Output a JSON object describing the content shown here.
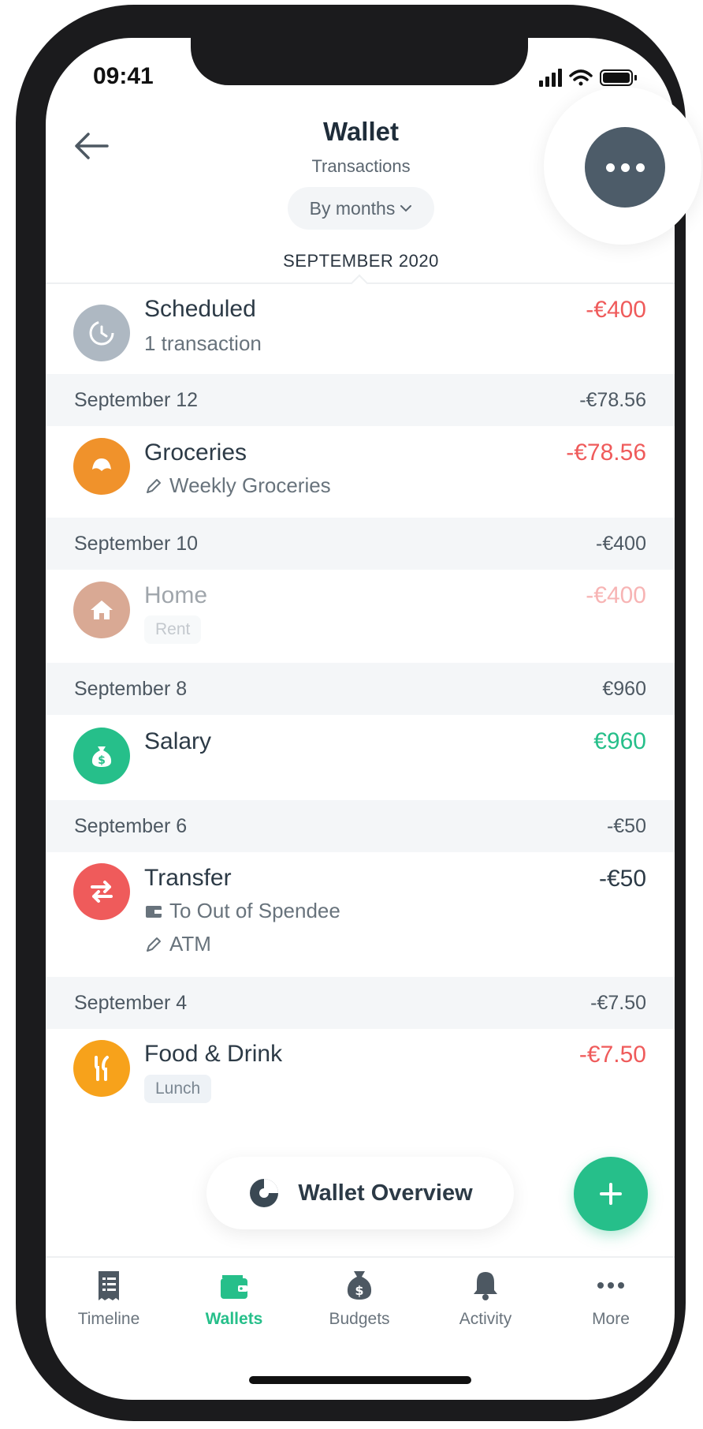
{
  "status": {
    "time": "09:41"
  },
  "header": {
    "title": "Wallet",
    "subtitle": "Transactions",
    "filter_label": "By months",
    "month": "SEPTEMBER 2020"
  },
  "scheduled": {
    "title": "Scheduled",
    "subtitle": "1 transaction",
    "amount": "-€400"
  },
  "days": [
    {
      "date": "September 12",
      "total": "-€78.56",
      "tx": {
        "title": "Groceries",
        "note": "Weekly Groceries",
        "amount": "-€78.56"
      }
    },
    {
      "date": "September 10",
      "total": "-€400",
      "tx": {
        "title": "Home",
        "tag": "Rent",
        "amount": "-€400"
      }
    },
    {
      "date": "September 8",
      "total": "€960",
      "tx": {
        "title": "Salary",
        "amount": "€960"
      }
    },
    {
      "date": "September 6",
      "total": "-€50",
      "tx": {
        "title": "Transfer",
        "wallet": "To Out of Spendee",
        "note": "ATM",
        "amount": "-€50"
      }
    },
    {
      "date": "September 4",
      "total": "-€7.50",
      "tx": {
        "title": "Food & Drink",
        "tag": "Lunch",
        "amount": "-€7.50"
      }
    }
  ],
  "overview_label": "Wallet Overview",
  "tabs": [
    {
      "label": "Timeline",
      "icon": "receipt-icon"
    },
    {
      "label": "Wallets",
      "icon": "wallet-icon"
    },
    {
      "label": "Budgets",
      "icon": "money-bag-icon"
    },
    {
      "label": "Activity",
      "icon": "bell-icon"
    },
    {
      "label": "More",
      "icon": "dots-icon"
    }
  ],
  "colors": {
    "accent": "#26bf8a",
    "negative": "#ef5b5b",
    "groceries": "#f0922b",
    "home": "#d9a994",
    "salary": "#26bf8a",
    "transfer": "#ef5b5b",
    "food": "#f7a21b",
    "scheduled": "#aeb8c2"
  }
}
